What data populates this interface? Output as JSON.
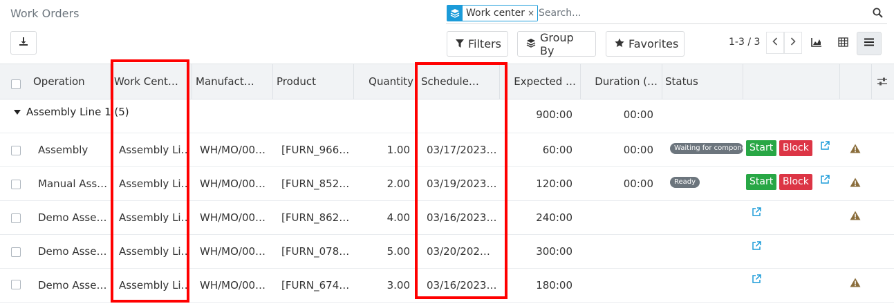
{
  "header": {
    "title": "Work Orders",
    "download_icon": "download-icon"
  },
  "search": {
    "facet_icon": "layers-icon",
    "facet_value": "Work center",
    "facet_remove": "×",
    "placeholder": "Search...",
    "search_icon": "magnifier-icon"
  },
  "toolbar": {
    "filters_label": "Filters",
    "groupby_label": "Group By",
    "favorites_label": "Favorites",
    "pager_text": "1-3 / 3",
    "views": [
      "graph-view-icon",
      "pivot-view-icon",
      "list-view-icon"
    ]
  },
  "columns": {
    "operation": "Operation",
    "work_center": "Work Cent…",
    "manufacturing": "Manufact…",
    "product": "Product",
    "quantity": "Quantity",
    "scheduled": "Schedule…",
    "expected": "Expected …",
    "duration": "Duration (…",
    "status": "Status"
  },
  "group": {
    "label": "Assembly Line 1 (5)",
    "expected_total": "900:00",
    "duration_total": "00:00"
  },
  "rows": [
    {
      "operation": "Assembly",
      "work_center": "Assembly Li…",
      "mo": "WH/MO/00…",
      "product": "[FURN_966…",
      "quantity": "1.00",
      "scheduled": "03/17/2023…",
      "expected": "60:00",
      "duration": "00:00",
      "status": "Waiting for components",
      "start": "Start",
      "block": "Block"
    },
    {
      "operation": "Manual Ass…",
      "work_center": "Assembly Li…",
      "mo": "WH/MO/00…",
      "product": "[FURN_852…",
      "quantity": "2.00",
      "scheduled": "03/19/2023…",
      "expected": "120:00",
      "duration": "00:00",
      "status": "Ready",
      "start": "Start",
      "block": "Block"
    },
    {
      "operation": "Demo Asse…",
      "work_center": "Assembly Li…",
      "mo": "WH/MO/00…",
      "product": "[FURN_862…",
      "quantity": "4.00",
      "scheduled": "03/16/2023…",
      "expected": "240:00",
      "duration": "",
      "status": "",
      "start": "",
      "block": ""
    },
    {
      "operation": "Demo Asse…",
      "work_center": "Assembly Li…",
      "mo": "WH/MO/00…",
      "product": "[FURN_078…",
      "quantity": "5.00",
      "scheduled": "03/20/202…",
      "expected": "300:00",
      "duration": "",
      "status": "",
      "start": "",
      "block": ""
    },
    {
      "operation": "Demo Asse…",
      "work_center": "Assembly Li…",
      "mo": "WH/MO/00…",
      "product": "[FURN_674…",
      "quantity": "3.00",
      "scheduled": "03/16/2023…",
      "expected": "180:00",
      "duration": "",
      "status": "",
      "start": "",
      "block": ""
    }
  ],
  "colors": {
    "accent": "#1b9bd9",
    "start": "#28a745",
    "block": "#dc3545",
    "warning": "#8a6d3b",
    "highlight": "#ff0000"
  }
}
